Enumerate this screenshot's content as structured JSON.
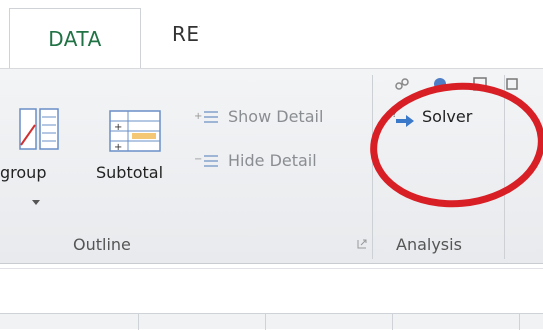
{
  "tabs": {
    "active": "DATA",
    "next": "REVIEW"
  },
  "outline_group": {
    "ungroup_label": "group",
    "subtotal_label": "Subtotal",
    "show_detail_label": "Show Detail",
    "hide_detail_label": "Hide Detail",
    "group_label": "Outline"
  },
  "analysis_group": {
    "solver_label": "Solver",
    "group_label": "Analysis"
  },
  "colors": {
    "active_tab": "#217346",
    "highlight": "#d81f26"
  }
}
